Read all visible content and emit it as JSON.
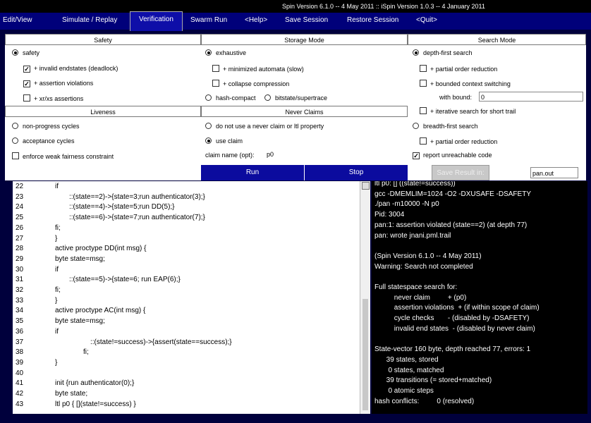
{
  "topbar": {
    "version": "Spin Version 6.1.0 -- 4 May 2011 :: iSpin Version 1.0.3 -- 4 January 2011"
  },
  "menu": [
    "Edit/View",
    "Simulate / Replay",
    "Verification",
    "Swarm Run",
    "<Help>",
    "Save Session",
    "Restore Session",
    "<Quit>"
  ],
  "headers": {
    "safety": "Safety",
    "storage": "Storage Mode",
    "search": "Search Mode",
    "liveness": "Liveness",
    "never": "Never Claims"
  },
  "safety": {
    "safety_label": "safety",
    "invalid_endstates": "+ invalid endstates (deadlock)",
    "assertion_violations": "+ assertion violations",
    "xrxs": "+ xr/xs assertions"
  },
  "liveness": {
    "non_progress": "non-progress cycles",
    "acceptance": "acceptance cycles",
    "weak_fairness": "enforce weak fairness constraint"
  },
  "storage": {
    "exhaustive": "exhaustive",
    "minimized": "+ minimized automata (slow)",
    "collapse": "+ collapse compression",
    "hash_compact": "hash-compact",
    "bitstate": "bitstate/supertrace"
  },
  "never": {
    "no_claim": "do not use a never claim or ltl property",
    "use_claim": "use claim",
    "claim_name_label": "claim name (opt):",
    "claim_name_value": "p0"
  },
  "search": {
    "dfs": "depth-first search",
    "partial_order": "+ partial order reduction",
    "bounded_context": "+ bounded context switching",
    "with_bound_label": "with bound:",
    "with_bound_value": "0",
    "iterative": "+ iterative search for short trail",
    "bfs": "breadth-first search",
    "bfs_partial_order": "+ partial order reduction",
    "report_unreachable": "report unreachable code"
  },
  "buttons": {
    "run": "Run",
    "stop": "Stop",
    "save_result": "Save Result in:",
    "save_file": "pan.out"
  },
  "colors": {
    "menubar": "#00007a",
    "active_tab": "#0e0ea8",
    "run_stop": "#0b0b9e",
    "background": "#00003c"
  },
  "code_lines": [
    {
      "n": "22",
      "t": "if"
    },
    {
      "n": "23",
      "t": "::(state==2)->{state=3;run authenticator(3);}"
    },
    {
      "n": "24",
      "t": "::(state==4)->{state=5;run DD(5);}"
    },
    {
      "n": "25",
      "t": "::(state==6)->{state=7;run authenticator(7);}"
    },
    {
      "n": "26",
      "t": "fi;"
    },
    {
      "n": "27",
      "t": "}"
    },
    {
      "n": "28",
      "t": "active proctype DD(int msg) {"
    },
    {
      "n": "29",
      "t": "byte state=msg;"
    },
    {
      "n": "30",
      "t": "if"
    },
    {
      "n": "31",
      "t": "::(state==5)->{state=6; run EAP(6);}"
    },
    {
      "n": "32",
      "t": "fi;"
    },
    {
      "n": "33",
      "t": "}"
    },
    {
      "n": "34",
      "t": "active proctype AC(int msg) {"
    },
    {
      "n": "35",
      "t": "byte state=msg;"
    },
    {
      "n": "36",
      "t": "if"
    },
    {
      "n": "37",
      "t": "::(state!=success)->{assert(state==success);}"
    },
    {
      "n": "38",
      "t": "fi;"
    },
    {
      "n": "39",
      "t": "}"
    },
    {
      "n": "40",
      "t": ""
    },
    {
      "n": "41",
      "t": "init {run authenticator(0);}"
    },
    {
      "n": "42",
      "t": "byte state;"
    },
    {
      "n": "43",
      "t": "ltl p0   { [](state!=success) }"
    }
  ],
  "console_lines": [
    "ltl p0: [] ((state!=success))",
    "gcc -DMEMLIM=1024 -O2 -DXUSAFE -DSAFETY",
    "./pan -m10000 -N p0",
    "Pid: 3004",
    "pan:1: assertion violated (state==2) (at depth 77)",
    "pan: wrote jnani.pml.trail",
    "",
    "(Spin Version 6.1.0 -- 4 May 2011)",
    "Warning: Search not completed",
    "",
    "Full statespace search for:",
    "          never claim         + (p0)",
    "          assertion violations  + (if within scope of claim)",
    "          cycle checks       - (disabled by -DSAFETY)",
    "          invalid end states  - (disabled by never claim)",
    "",
    "State-vector 160 byte, depth reached 77, errors: 1",
    "      39 states, stored",
    "       0 states, matched",
    "      39 transitions (= stored+matched)",
    "       0 atomic steps",
    "hash conflicts:         0 (resolved)"
  ]
}
